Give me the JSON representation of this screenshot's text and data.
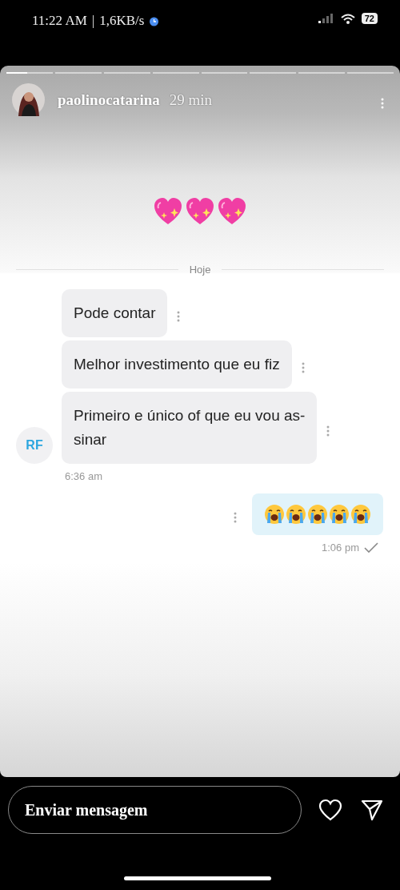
{
  "status_bar": {
    "time": "11:22 AM",
    "separator": "|",
    "speed": "1,6KB/s",
    "battery": "72"
  },
  "story": {
    "progress": [
      {
        "kind": "current",
        "level": 0.45
      },
      {
        "kind": "upcoming"
      },
      {
        "kind": "upcoming"
      },
      {
        "kind": "upcoming"
      },
      {
        "kind": "upcoming"
      },
      {
        "kind": "upcoming"
      },
      {
        "kind": "upcoming"
      },
      {
        "kind": "upcoming"
      }
    ],
    "username": "paolinocatarina",
    "age": "29 min",
    "stickers": [
      {
        "kind": "sparkling-heart"
      },
      {
        "kind": "sparkling-heart"
      },
      {
        "kind": "sparkling-heart"
      }
    ],
    "chat": {
      "date_divider": "Hoje",
      "incoming": {
        "avatar": "RF",
        "messages": [
          {
            "text": "Pode contar"
          },
          {
            "text": "Melhor investimento que eu fiz"
          },
          {
            "text": "Primeiro e único of que eu vou as-\nsinar"
          }
        ],
        "time": "6:36 am"
      },
      "outgoing": {
        "emojis": [
          {
            "kind": "crying-face"
          },
          {
            "kind": "crying-face"
          },
          {
            "kind": "crying-face"
          },
          {
            "kind": "crying-face"
          },
          {
            "kind": "crying-face"
          }
        ],
        "time": "1:06 pm",
        "delivered": true
      }
    }
  },
  "reply_bar": {
    "placeholder": "Enviar mensagem"
  }
}
